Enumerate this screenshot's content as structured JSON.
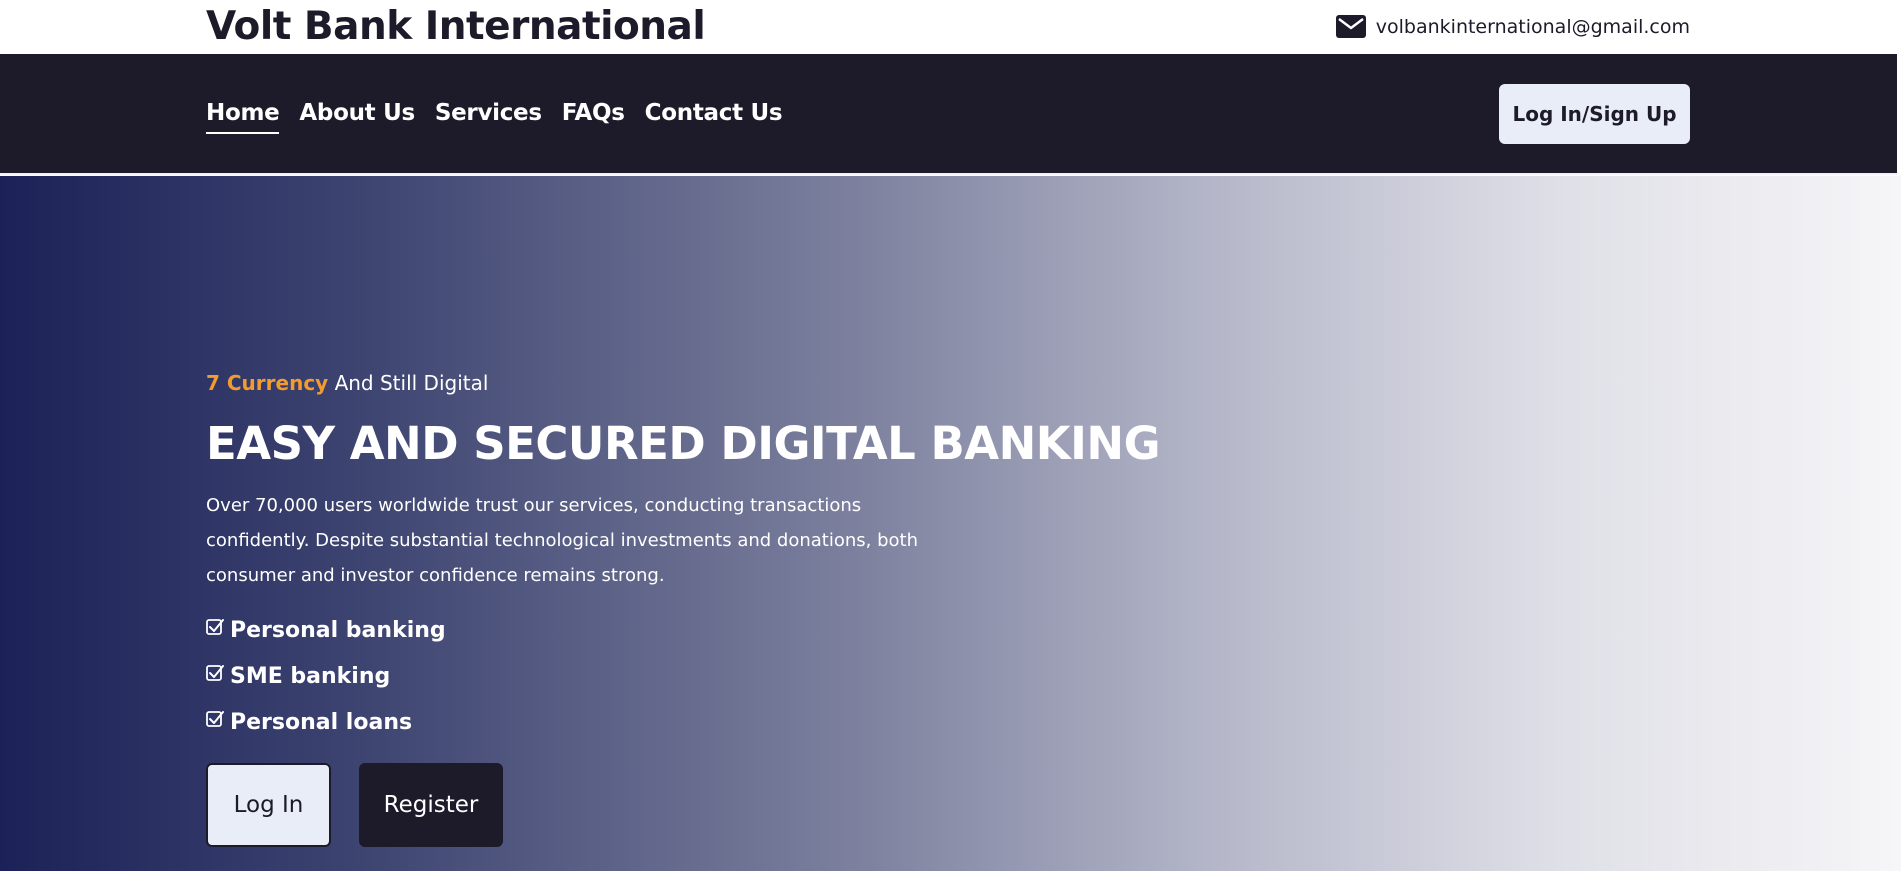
{
  "header": {
    "brand": "Volt Bank International",
    "email": "volbankinternational@gmail.com",
    "email_icon": "envelope-icon"
  },
  "nav": {
    "items": [
      {
        "label": "Home",
        "active": true
      },
      {
        "label": "About Us"
      },
      {
        "label": "Services"
      },
      {
        "label": "FAQs"
      },
      {
        "label": "Contact Us"
      }
    ],
    "auth_button": "Log In/Sign Up"
  },
  "hero": {
    "tagline_accent": "7 Currency",
    "tagline_rest": "And Still Digital",
    "title": "EASY AND SECURED DIGITAL BANKING",
    "description": "Over 70,000 users worldwide trust our services, conducting transactions confidently. Despite substantial technological investments and donations, both consumer and investor confidence remains strong.",
    "features": [
      {
        "label": "Personal banking",
        "icon": "checkbox-checked-icon"
      },
      {
        "label": "SME banking",
        "icon": "checkbox-checked-icon"
      },
      {
        "label": "Personal loans",
        "icon": "checkbox-checked-icon"
      }
    ],
    "login_button": "Log In",
    "register_button": "Register"
  },
  "colors": {
    "dark": "#1d1b2a",
    "accent": "#f29b2e",
    "light_button": "#e8edf7",
    "gradient_start": "#1c2157",
    "gradient_end": "#f6f6f8"
  }
}
